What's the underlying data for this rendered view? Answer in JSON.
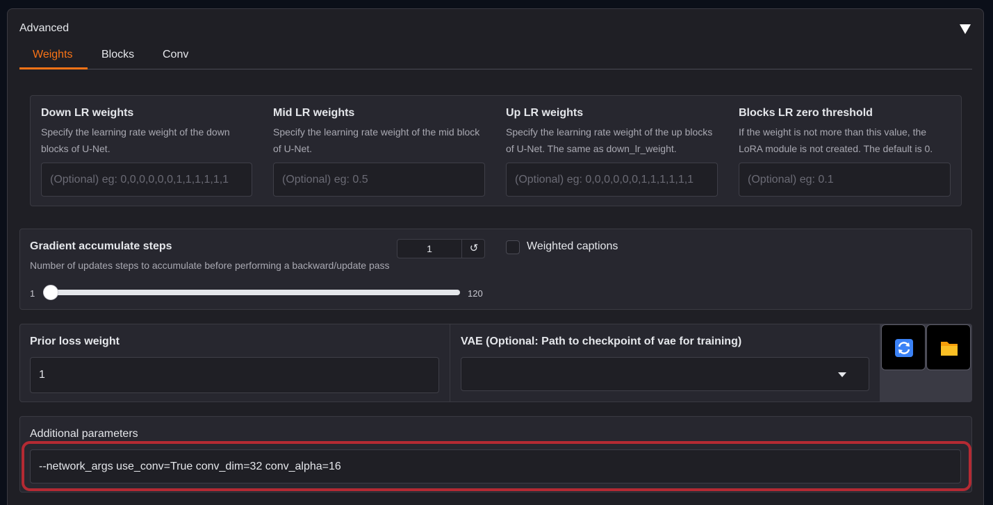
{
  "section": {
    "title": "Advanced"
  },
  "tabs": [
    {
      "label": "Weights",
      "active": true
    },
    {
      "label": "Blocks",
      "active": false
    },
    {
      "label": "Conv",
      "active": false
    }
  ],
  "lr_fields": [
    {
      "label": "Down LR weights",
      "info_line1": "Specify the learning rate weight of the down",
      "info_line2": "blocks of U-Net.",
      "placeholder": "(Optional) eg: 0,0,0,0,0,0,1,1,1,1,1,1"
    },
    {
      "label": "Mid LR weights",
      "info_line1": "Specify the learning rate weight of the mid block",
      "info_line2": "of U-Net.",
      "placeholder": "(Optional) eg: 0.5"
    },
    {
      "label": "Up LR weights",
      "info_line1": "Specify the learning rate weight of the up blocks",
      "info_line2": "of U-Net. The same as down_lr_weight.",
      "placeholder": "(Optional) eg: 0,0,0,0,0,0,1,1,1,1,1,1"
    },
    {
      "label": "Blocks LR zero threshold",
      "info_line1": "If the weight is not more than this value, the",
      "info_line2": "LoRA module is not created. The default is 0.",
      "placeholder": "(Optional) eg: 0.1"
    }
  ],
  "gradient": {
    "label": "Gradient accumulate steps",
    "info": "Number of updates steps to accumulate before performing a backward/update pass",
    "value": "1",
    "min": "1",
    "max": "120",
    "reset_glyph": "↺"
  },
  "weighted_captions": {
    "label": "Weighted captions",
    "checked": false
  },
  "prior_loss": {
    "label": "Prior loss weight",
    "value": "1"
  },
  "vae": {
    "label": "VAE (Optional: Path to checkpoint of vae for training)",
    "value": ""
  },
  "buttons": {
    "refresh_icon": "refresh-icon",
    "folder_icon": "folder-icon"
  },
  "additional": {
    "label": "Additional parameters",
    "value": "--network_args use_conv=True conv_dim=32 conv_alpha=16"
  },
  "colors": {
    "accent": "#f97316",
    "highlight": "#b42a33",
    "refresh_blue": "#3b82f6",
    "folder_yellow": "#fbbf24"
  }
}
